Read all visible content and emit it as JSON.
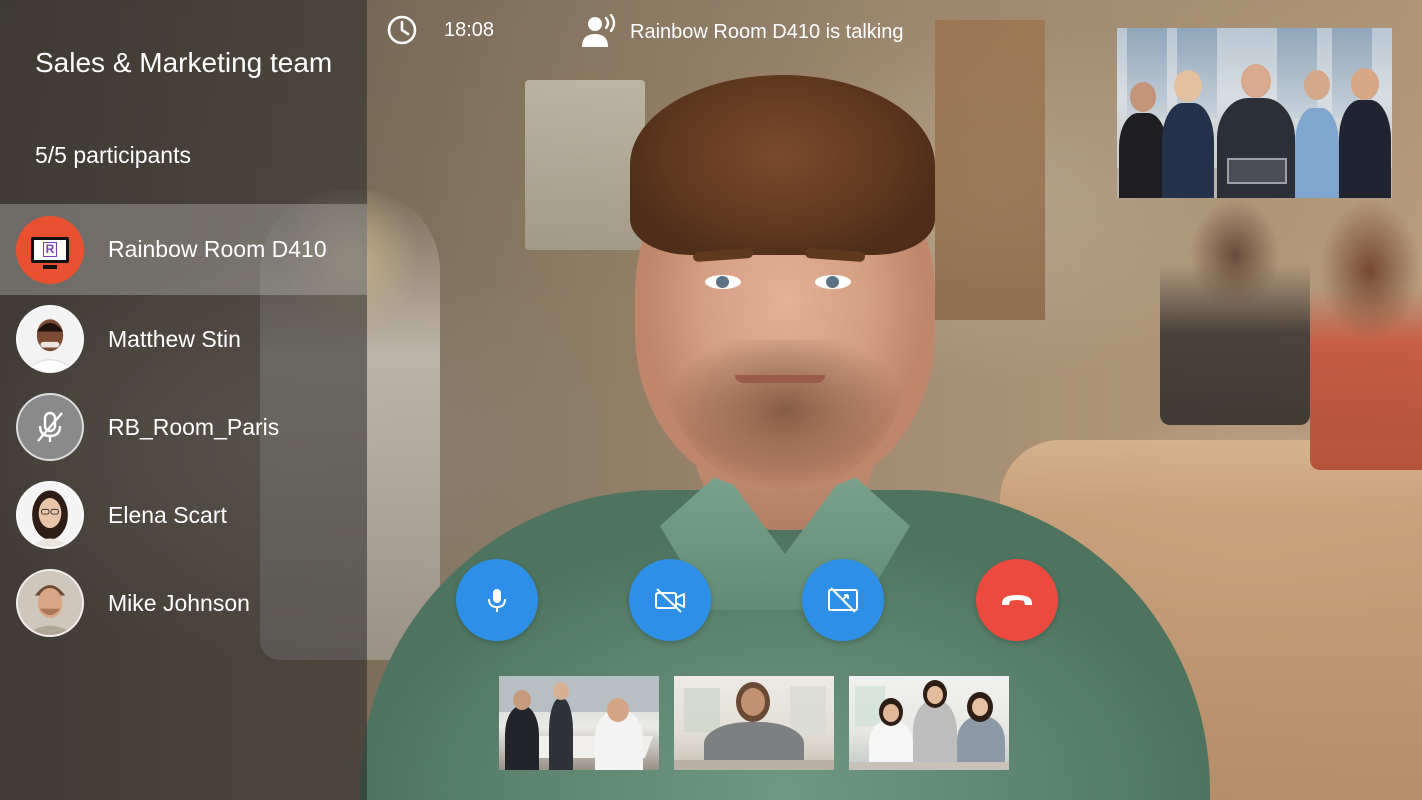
{
  "conference": {
    "title": "Sales & Marketing team",
    "participants_count": "5/5 participants"
  },
  "participants": [
    {
      "name": "Rainbow Room D410",
      "avatar": "room-tv-icon",
      "active": true
    },
    {
      "name": "Matthew Stin",
      "avatar": "photo"
    },
    {
      "name": "RB_Room_Paris",
      "avatar": "mic-muted-icon"
    },
    {
      "name": "Elena Scart",
      "avatar": "photo"
    },
    {
      "name": "Mike Johnson",
      "avatar": "photo"
    }
  ],
  "status": {
    "time": "18:08",
    "talking": "Rainbow Room D410 is talking"
  },
  "room_logo_letter": "R",
  "controls": {
    "mic": "microphone-icon",
    "camera": "camera-off-icon",
    "share": "screen-share-off-icon",
    "hangup": "hang-up-icon"
  },
  "colors": {
    "accent": "#2d8fe8",
    "hangup": "#ec4a3f",
    "room_avatar": "#e8502f"
  }
}
